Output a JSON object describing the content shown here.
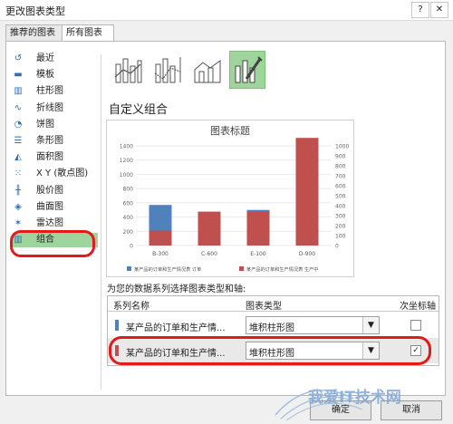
{
  "window": {
    "title": "更改图表类型",
    "help_label": "?",
    "close_label": "✕"
  },
  "tabs": [
    {
      "label": "推荐的图表",
      "active": false
    },
    {
      "label": "所有图表",
      "active": true
    }
  ],
  "sidebar": {
    "items": [
      {
        "label": "最近",
        "icon": "recent-icon",
        "glyph": "↺"
      },
      {
        "label": "模板",
        "icon": "folder-icon",
        "glyph": "▬"
      },
      {
        "label": "柱形图",
        "icon": "column-chart-icon",
        "glyph": "▥"
      },
      {
        "label": "折线图",
        "icon": "line-chart-icon",
        "glyph": "∿"
      },
      {
        "label": "饼图",
        "icon": "pie-chart-icon",
        "glyph": "◔"
      },
      {
        "label": "条形图",
        "icon": "bar-chart-icon",
        "glyph": "☰"
      },
      {
        "label": "面积图",
        "icon": "area-chart-icon",
        "glyph": "◭"
      },
      {
        "label": "X Y (散点图)",
        "icon": "scatter-chart-icon",
        "glyph": "⁙"
      },
      {
        "label": "股价图",
        "icon": "stock-chart-icon",
        "glyph": "╫"
      },
      {
        "label": "曲面图",
        "icon": "surface-chart-icon",
        "glyph": "◈"
      },
      {
        "label": "雷达图",
        "icon": "radar-chart-icon",
        "glyph": "✶"
      },
      {
        "label": "组合",
        "icon": "combo-chart-icon",
        "glyph": "▥",
        "selected": true
      }
    ]
  },
  "chart_type_buttons": [
    {
      "name": "clustered-column-line-icon"
    },
    {
      "name": "clustered-column-line-secondary-icon"
    },
    {
      "name": "stacked-area-column-icon"
    },
    {
      "name": "custom-combination-icon",
      "selected": true
    }
  ],
  "section_title": "自定义组合",
  "colors": {
    "blue": "#4f81bd",
    "red": "#c0504d",
    "highlight": "#9fd49c",
    "annotation": "#e21a1a"
  },
  "chart_data": {
    "type": "bar",
    "title": "图表标题",
    "categories": [
      "B-300",
      "C-600",
      "E-100",
      "D-900"
    ],
    "series": [
      {
        "name": "某产品的订单和生产情况表 订单",
        "values": [
          570,
          360,
          500,
          0
        ],
        "axis": "primary",
        "color": "#4f81bd"
      },
      {
        "name": "某产品的订单和生产情况表 生产中",
        "values": [
          150,
          340,
          340,
          1080
        ],
        "axis": "secondary",
        "color": "#c0504d"
      }
    ],
    "y_primary": {
      "ticks": [
        "0",
        "200",
        "400",
        "600",
        "800",
        "1000",
        "1200",
        "1400"
      ],
      "ylim": [
        0,
        1400
      ]
    },
    "y_secondary": {
      "ticks": [
        "0",
        "100",
        "200",
        "300",
        "400",
        "500",
        "600",
        "700",
        "800",
        "900",
        "1000"
      ],
      "ylim": [
        0,
        1000
      ]
    },
    "legend_position": "bottom"
  },
  "series_panel": {
    "hint": "为您的数据系列选择图表类型和轴:",
    "headers": {
      "name": "系列名称",
      "type": "图表类型",
      "axis": "次坐标轴"
    },
    "rows": [
      {
        "name": "某产品的订单和生产情...",
        "type": "堆积柱形图",
        "secondary": false,
        "color": "#4f81bd",
        "check": ""
      },
      {
        "name": "某产品的订单和生产情...",
        "type": "堆积柱形图",
        "secondary": true,
        "color": "#c0504d",
        "check": "✓"
      }
    ]
  },
  "buttons": {
    "ok": "确定",
    "cancel": "取消"
  },
  "watermark": {
    "text": "我爱IT技术网"
  }
}
